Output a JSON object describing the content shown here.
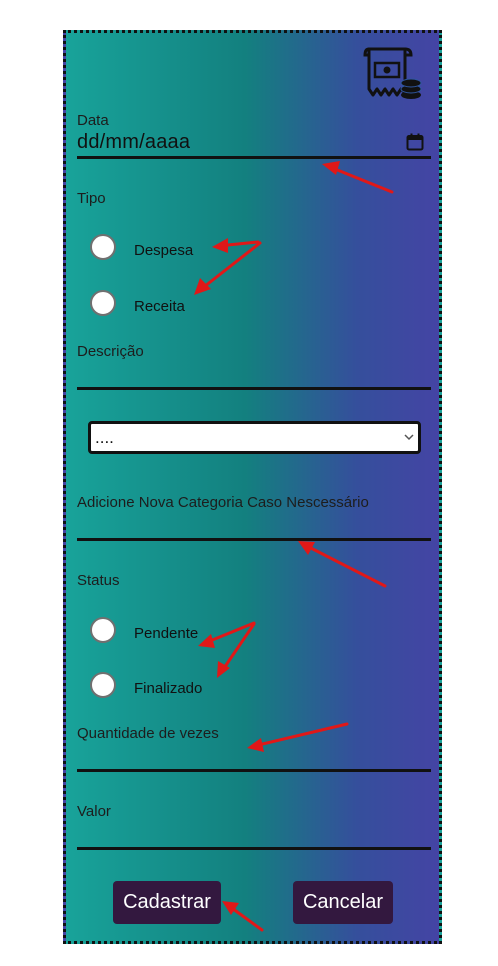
{
  "form": {
    "date_label": "Data",
    "date_value": "dd/mm/aaaa",
    "type_label": "Tipo",
    "type_options": [
      "Despesa",
      "Receita"
    ],
    "description_label": "Descrição",
    "category_select_value": "....",
    "new_category_label": "Adicione Nova Categoria Caso Nescessário",
    "status_label": "Status",
    "status_options": [
      "Pendente",
      "Finalizado"
    ],
    "quantity_label": "Quantidade de vezes",
    "value_label": "Valor",
    "submit_label": "Cadastrar",
    "cancel_label": "Cancelar"
  },
  "colors": {
    "gradient_left": "#18a39a",
    "gradient_right": "#4444a4",
    "button_bg": "#33183f",
    "annotation_arrow": "#e01818"
  },
  "icons": [
    "receipt-coins-logo-icon",
    "calendar-icon",
    "chevron-down-icon"
  ]
}
